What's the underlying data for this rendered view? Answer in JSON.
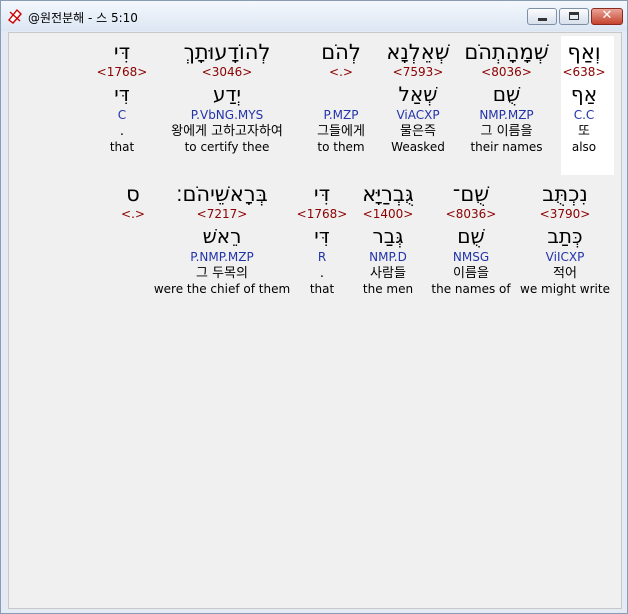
{
  "window": {
    "title": "@원전분해 - 스 5:10",
    "close_glyph": "✕"
  },
  "rows": [
    [
      {
        "heb": "וְאַף",
        "strong": "<638>",
        "lemma": "אַף",
        "morph": "C.C",
        "kor": "또",
        "eng": "also",
        "highlight": true
      },
      {
        "heb": "שְׁמָהָתְהֹם",
        "strong": "<8036>",
        "lemma": "שֻׁם",
        "morph": "NMP.MZP",
        "kor": "그 이름을",
        "eng": "their names"
      },
      {
        "heb": "שְׁאֵלְנָא",
        "strong": "<7593>",
        "lemma": "שְׁאַל",
        "morph": "ViACXP",
        "kor": "물은즉",
        "eng": "Weasked"
      },
      {
        "heb": "לְהֹם",
        "strong": "<.>",
        "lemma": "",
        "morph": "P.MZP",
        "kor": "그들에게",
        "eng": "to them"
      },
      {
        "heb": "לְהוֹדָעוּתָךְ",
        "strong": "<3046>",
        "lemma": "יְדַע",
        "morph": "P.VbNG.MYS",
        "kor": "왕에게 고하고자하여",
        "eng": "to certify thee"
      },
      {
        "heb": "דִּי",
        "strong": "<1768>",
        "lemma": "דִּי",
        "morph": "C",
        "kor": ".",
        "eng": "that"
      }
    ],
    [
      {
        "heb": "נִכְתֻּב",
        "strong": "<3790>",
        "lemma": "כְּתַב",
        "morph": "ViICXP",
        "kor": "적어",
        "eng": "we might write"
      },
      {
        "heb": "שֻׁם־",
        "strong": "<8036>",
        "lemma": "שֻׁם",
        "morph": "NMSG",
        "kor": "이름을",
        "eng": "the names of"
      },
      {
        "heb": "גֻּבְרַיָּא",
        "strong": "<1400>",
        "lemma": "גְּבַר",
        "morph": "NMP.D",
        "kor": "사람들",
        "eng": "the men"
      },
      {
        "heb": "דִּי",
        "strong": "<1768>",
        "lemma": "דִּי",
        "morph": "R",
        "kor": ".",
        "eng": "that"
      },
      {
        "heb": "בְּרָאשֵׁיהֹם׃",
        "strong": "<7217>",
        "lemma": "רֵאשׁ",
        "morph": "P.NMP.MZP",
        "kor": "그 두목의",
        "eng": "were the chief of them"
      },
      {
        "heb": "ס",
        "strong": "<.>",
        "lemma": "",
        "morph": "",
        "kor": "",
        "eng": ""
      }
    ]
  ]
}
